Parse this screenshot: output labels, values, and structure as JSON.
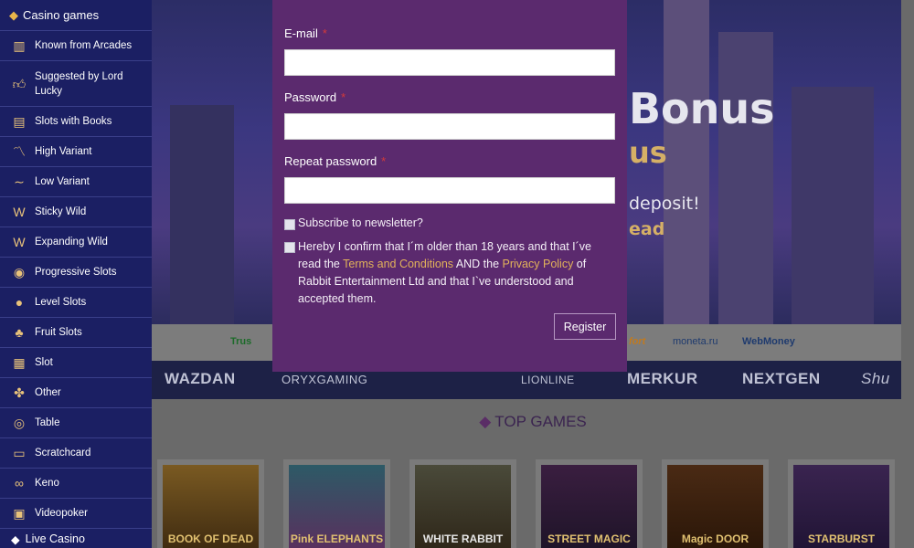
{
  "sidebar": {
    "header": {
      "label": "Casino games",
      "icon": "dice-icon"
    },
    "items": [
      {
        "label": "Known from Arcades",
        "icon": "arcade-icon"
      },
      {
        "label": "Suggested by Lord Lucky",
        "icon": "thumbs-up-icon"
      },
      {
        "label": "Slots with Books",
        "icon": "book-icon"
      },
      {
        "label": "High Variant",
        "icon": "trend-high-icon"
      },
      {
        "label": "Low Variant",
        "icon": "trend-low-icon"
      },
      {
        "label": "Sticky Wild",
        "icon": "wild-icon"
      },
      {
        "label": "Expanding Wild",
        "icon": "expanding-wild-icon"
      },
      {
        "label": "Progressive Slots",
        "icon": "progressive-icon"
      },
      {
        "label": "Level Slots",
        "icon": "level-icon"
      },
      {
        "label": "Fruit Slots",
        "icon": "cherry-icon"
      },
      {
        "label": "Slot",
        "icon": "slot-machine-icon"
      },
      {
        "label": "Other",
        "icon": "clover-icon"
      },
      {
        "label": "Table",
        "icon": "roulette-icon"
      },
      {
        "label": "Scratchcard",
        "icon": "scratchcard-icon"
      },
      {
        "label": "Keno",
        "icon": "keno-icon"
      },
      {
        "label": "Videopoker",
        "icon": "videopoker-icon"
      }
    ],
    "footer": {
      "label": "Live Casino"
    }
  },
  "hero": {
    "title": "Bonus",
    "subtitle": "us",
    "line1": "deposit!",
    "line2": "ead"
  },
  "payments": [
    "Trus",
    "fort",
    "moneta.ru",
    "WebMoney"
  ],
  "providers": [
    "WAZDAN",
    "ORYXGAMING",
    "LIONLINE",
    "MERKUR",
    "NEXTGEN",
    "Shu"
  ],
  "top_games": {
    "title": "TOP GAMES",
    "games": [
      "BOOK OF DEAD",
      "Pink ELEPHANTS",
      "WHITE RABBIT",
      "STREET MAGIC",
      "Magic DOOR",
      "STARBURST"
    ]
  },
  "register_form": {
    "email_label": "E-mail",
    "password_label": "Password",
    "repeat_password_label": "Repeat password",
    "required_mark": "*",
    "email_value": "",
    "password_value": "",
    "repeat_password_value": "",
    "newsletter_label": "Subscribe to newsletter?",
    "confirm_text_1": "Hereby I confirm that I´m older than 18 years and that I´ve read the ",
    "terms_link": "Terms and Conditions",
    "confirm_text_2": " AND the ",
    "privacy_link": "Privacy Policy",
    "confirm_text_3": " of Rabbit Entertainment Ltd and that I`ve understood and accepted them.",
    "register_button": "Register"
  },
  "colors": {
    "sidebar_bg": "#1b1f63",
    "modal_bg": "#5b2a6e",
    "link": "#e2b25a",
    "required": "#d43a3a"
  }
}
